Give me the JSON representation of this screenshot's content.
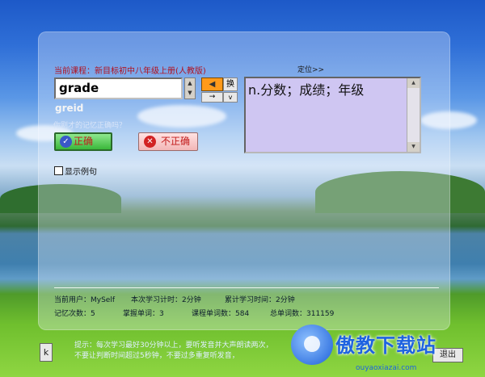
{
  "course": {
    "label": "当前课程：新目标初中八年级上册(人教版)"
  },
  "locate": {
    "label": "定位>>"
  },
  "word": {
    "value": "grade",
    "phonetic": "greid"
  },
  "controls": {
    "speak_icon": "speaker-icon",
    "swap_label": "换",
    "arrow_label": "→",
    "v_label": "v"
  },
  "prompt": {
    "remember": "你刚才的记忆正确吗？"
  },
  "buttons": {
    "correct": "正确",
    "wrong": "不正确",
    "exit": "退出",
    "k": "k"
  },
  "options": {
    "show_example": "显示例句"
  },
  "meaning": {
    "text": "n.分数；成绩；年级"
  },
  "stats": {
    "current_user": "当前用户：MySelf",
    "session_time": "本次学习计时：2分钟",
    "total_time": "累计学习时间：2分钟",
    "memory_count": "记忆次数：5",
    "mastered_words": "掌握单词：3",
    "course_words": "课程单词数：584",
    "total_words": "总单词数：311159"
  },
  "tip": {
    "line1": "提示：每次学习最好30分钟以上，要听发音并大声朗读两次，",
    "line2": "不要让判断时间超过5秒钟，不要过多重复听发音，"
  },
  "watermark": {
    "text": "傲教下载站",
    "url": "ouyaoxiazai.com"
  }
}
